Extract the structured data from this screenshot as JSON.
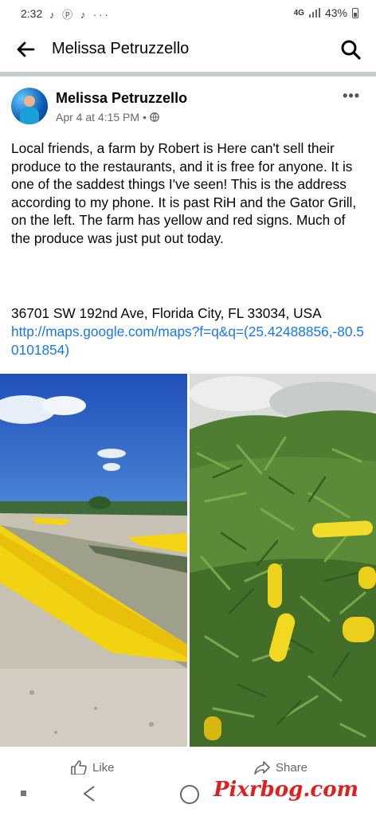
{
  "status_bar": {
    "time": "2:32",
    "network": "4G",
    "battery": "43%"
  },
  "header": {
    "title": "Melissa Petruzzello"
  },
  "post": {
    "author": "Melissa Petruzzello",
    "timestamp": "Apr 4 at 4:15 PM",
    "separator": "•",
    "body": "Local friends, a farm by Robert is Here can't sell their produce to the restaurants, and it is free for anyone. It is one of the saddest things I've seen! This is the address according to my phone. It is past RiH and the Gator Grill, on the left. The farm has yellow and red signs. Much of the produce was just put out today.",
    "address": "36701 SW 192nd Ave, Florida City, FL 33034, USA",
    "link": "http://maps.google.com/maps?f=q&q=(25.42488856,-80.50101854)"
  },
  "actions": {
    "like": "Like",
    "share": "Share"
  },
  "watermark": "Pixrbog.com"
}
